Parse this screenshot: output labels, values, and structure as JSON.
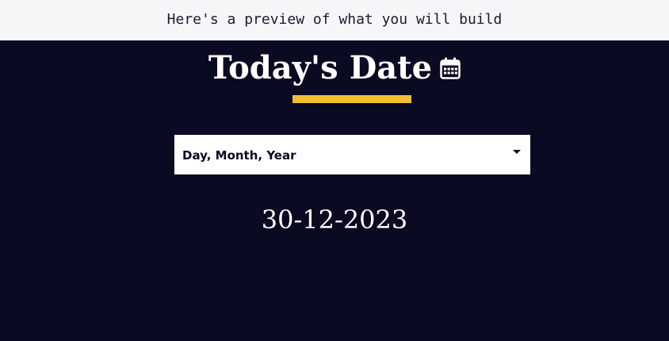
{
  "banner": {
    "text": "Here's a preview of what you will build"
  },
  "header": {
    "title": "Today's Date",
    "icon": "calendar-icon",
    "underline_color": "#f1be32"
  },
  "format_select": {
    "selected": "Day, Month, Year",
    "icon": "caret-down-icon"
  },
  "date_display": {
    "value": "30-12-2023"
  },
  "colors": {
    "background": "#0a0a23",
    "banner_background": "#f5f6f7",
    "accent": "#f1be32",
    "text": "#ffffff"
  }
}
